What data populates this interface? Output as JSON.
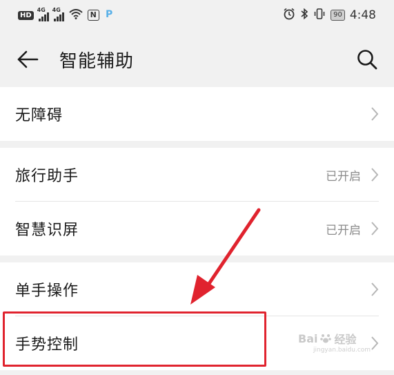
{
  "status": {
    "hd": "HD",
    "net1": "4G",
    "net2": "4G",
    "nfc": "N",
    "battery": "90",
    "time": "4:48"
  },
  "header": {
    "title": "智能辅助"
  },
  "icons": {
    "back": "arrow-left-icon",
    "search": "search-icon",
    "chevron": "chevron-right-icon"
  },
  "sections": [
    {
      "items": [
        {
          "label": "无障碍",
          "value": ""
        }
      ]
    },
    {
      "items": [
        {
          "label": "旅行助手",
          "value": "已开启"
        },
        {
          "label": "智慧识屏",
          "value": "已开启"
        }
      ]
    },
    {
      "items": [
        {
          "label": "单手操作",
          "value": ""
        },
        {
          "label": "手势控制",
          "value": ""
        }
      ]
    }
  ],
  "watermark": {
    "brand": "Bai",
    "cn": "经验",
    "url": "jingyan.baidu.com"
  },
  "colors": {
    "annotation_red": "#e0232e",
    "background": "#f1f1f1"
  }
}
